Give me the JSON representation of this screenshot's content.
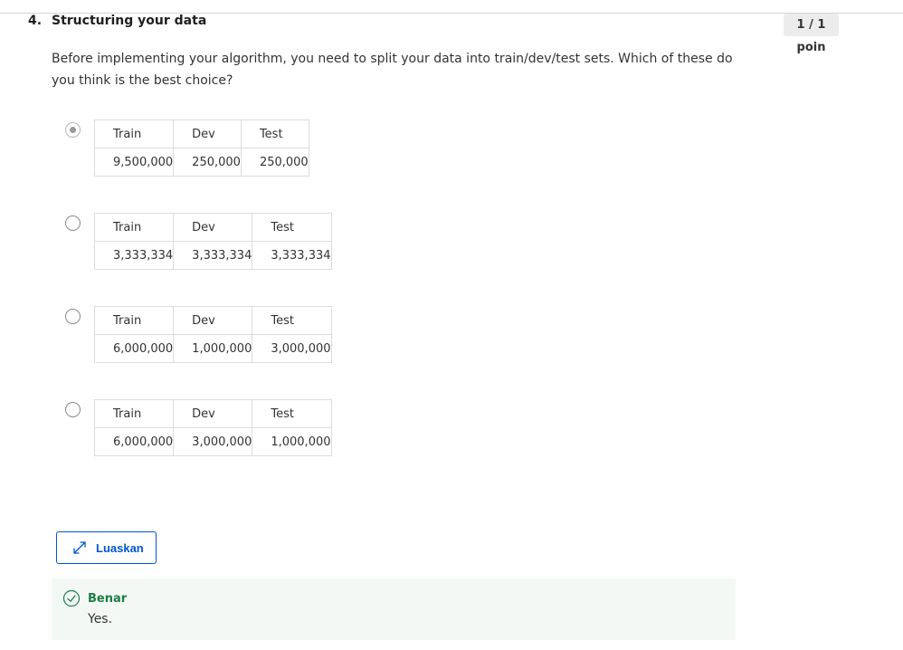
{
  "question": {
    "number": "4.",
    "title": "Structuring your data",
    "points": "1 / 1 poin",
    "prompt": "Before implementing your algorithm, you need to split your data into train/dev/test sets. Which of these do you think is the best choice?"
  },
  "options": [
    {
      "selected": true,
      "headers": [
        "Train",
        "Dev",
        "Test"
      ],
      "values": [
        "9,500,000",
        "250,000",
        "250,000"
      ]
    },
    {
      "selected": false,
      "headers": [
        "Train",
        "Dev",
        "Test"
      ],
      "values": [
        "3,333,334",
        "3,333,334",
        "3,333,334"
      ]
    },
    {
      "selected": false,
      "headers": [
        "Train",
        "Dev",
        "Test"
      ],
      "values": [
        "6,000,000",
        "1,000,000",
        "3,000,000"
      ]
    },
    {
      "selected": false,
      "headers": [
        "Train",
        "Dev",
        "Test"
      ],
      "values": [
        "6,000,000",
        "3,000,000",
        "1,000,000"
      ]
    }
  ],
  "expand_button": {
    "label": "Luaskan",
    "icon": "expand-icon"
  },
  "feedback": {
    "status": "Benar",
    "text": "Yes.",
    "icon": "check-circle-icon",
    "color": "#1e7d45"
  },
  "colors": {
    "accent": "#0056d2",
    "success": "#1e7d45",
    "feedback_bg": "#f3f8f5"
  }
}
